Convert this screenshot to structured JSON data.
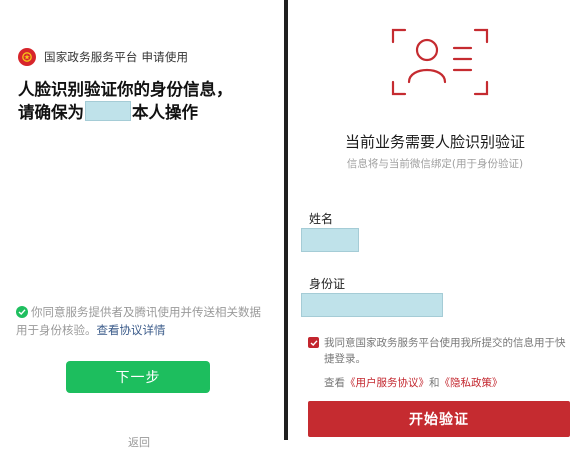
{
  "left_panel": {
    "app_title": "国家政务服务平台 申请使用",
    "headline_line1": "人脸识别验证你的身份信息，",
    "headline_line2_prefix": "请确保为",
    "headline_line2_suffix": "本人操作",
    "consent_text": "你同意服务提供者及腾讯使用并传送相关数据用于身份核验。",
    "consent_link": "查看协议详情",
    "next_button": "下一步",
    "cut_text": "返回"
  },
  "right_panel": {
    "face_icon": "face-recognition-icon",
    "title": "当前业务需要人脸识别验证",
    "subtitle": "信息将与当前微信绑定(用于身份验证)",
    "name_label": "姓名",
    "id_label": "身份证",
    "consent_text": "我同意国家政务服务平台使用我所提交的信息用于快捷登录。",
    "policy_prefix": "查看",
    "user_agreement": "《用户服务协议》",
    "policy_and": "和",
    "privacy_policy": "《隐私政策》",
    "start_button": "开始验证"
  },
  "colors": {
    "accent_green": "#1dbe5e",
    "accent_red": "#c52b30",
    "mask_blue": "#bfe2ea"
  }
}
